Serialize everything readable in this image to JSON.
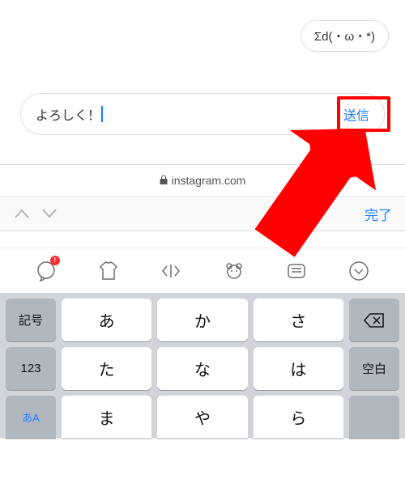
{
  "message": {
    "last_bubble": "Σd(・ω・*)"
  },
  "composer": {
    "text": "よろしく！",
    "send_label": "送信"
  },
  "url_bar": {
    "domain": "instagram.com"
  },
  "toolbar": {
    "done_label": "完了"
  },
  "keyboard": {
    "row1": {
      "left": "記号",
      "k1": "あ",
      "k2": "か",
      "k3": "さ",
      "right_icon": "backspace"
    },
    "row2": {
      "left": "123",
      "k1": "た",
      "k2": "な",
      "k3": "は",
      "right": "空白"
    },
    "row3": {
      "left": "あA",
      "k1": "ま",
      "k2": "や",
      "k3": "ら"
    }
  },
  "emoji_bar_icons": [
    "chat-bubble",
    "shirt",
    "code-input",
    "bear",
    "message",
    "chevron-down-circle"
  ]
}
